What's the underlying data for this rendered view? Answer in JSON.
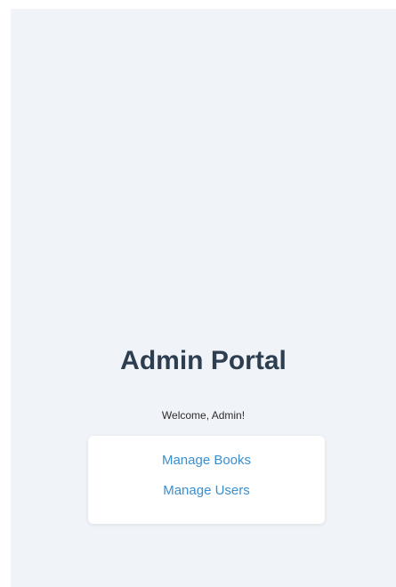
{
  "header": {
    "title": "Admin Portal",
    "welcome": "Welcome, Admin!"
  },
  "menu": {
    "items": [
      {
        "label": "Manage Books"
      },
      {
        "label": "Manage Users"
      }
    ]
  },
  "colors": {
    "background": "#f0f4f8",
    "title": "#2c3e50",
    "link": "#3a8fd0",
    "card": "#ffffff"
  }
}
